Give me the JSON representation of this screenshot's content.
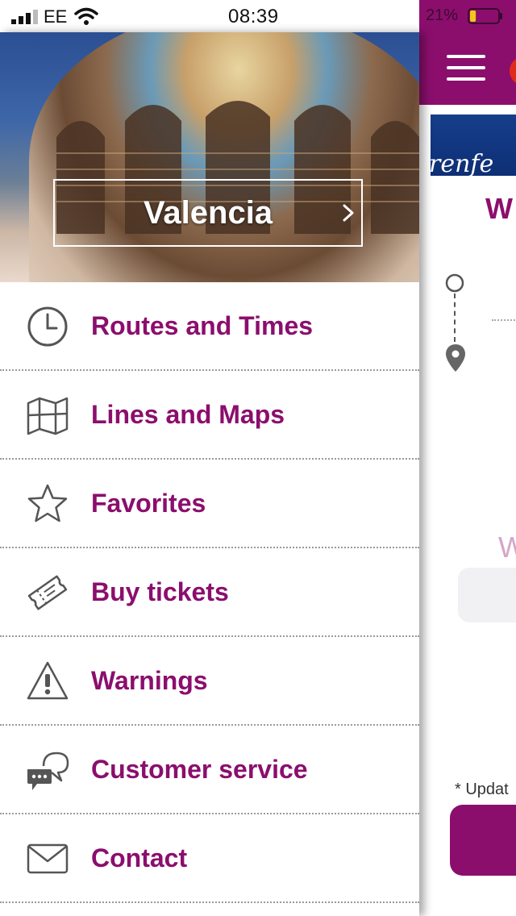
{
  "status_bar": {
    "carrier": "EE",
    "time": "08:39",
    "battery_percent": "21%",
    "battery_level": 0.21,
    "icons": [
      "signal-icon",
      "wifi-icon",
      "battery-icon"
    ]
  },
  "drawer": {
    "city": "Valencia",
    "menu": [
      {
        "label": "Routes and Times",
        "icon": "clock-icon"
      },
      {
        "label": "Lines and Maps",
        "icon": "map-icon"
      },
      {
        "label": "Favorites",
        "icon": "star-icon"
      },
      {
        "label": "Buy tickets",
        "icon": "ticket-icon"
      },
      {
        "label": "Warnings",
        "icon": "warning-icon"
      },
      {
        "label": "Customer service",
        "icon": "chat-icon"
      },
      {
        "label": "Contact",
        "icon": "mail-icon"
      }
    ]
  },
  "main": {
    "logo_text": "renfe",
    "heading_partial": "W",
    "faint_partial": "W",
    "update_note": "* Updat"
  },
  "colors": {
    "brand_purple": "#8b0e6d",
    "renfe_blue": "#173e8b"
  }
}
